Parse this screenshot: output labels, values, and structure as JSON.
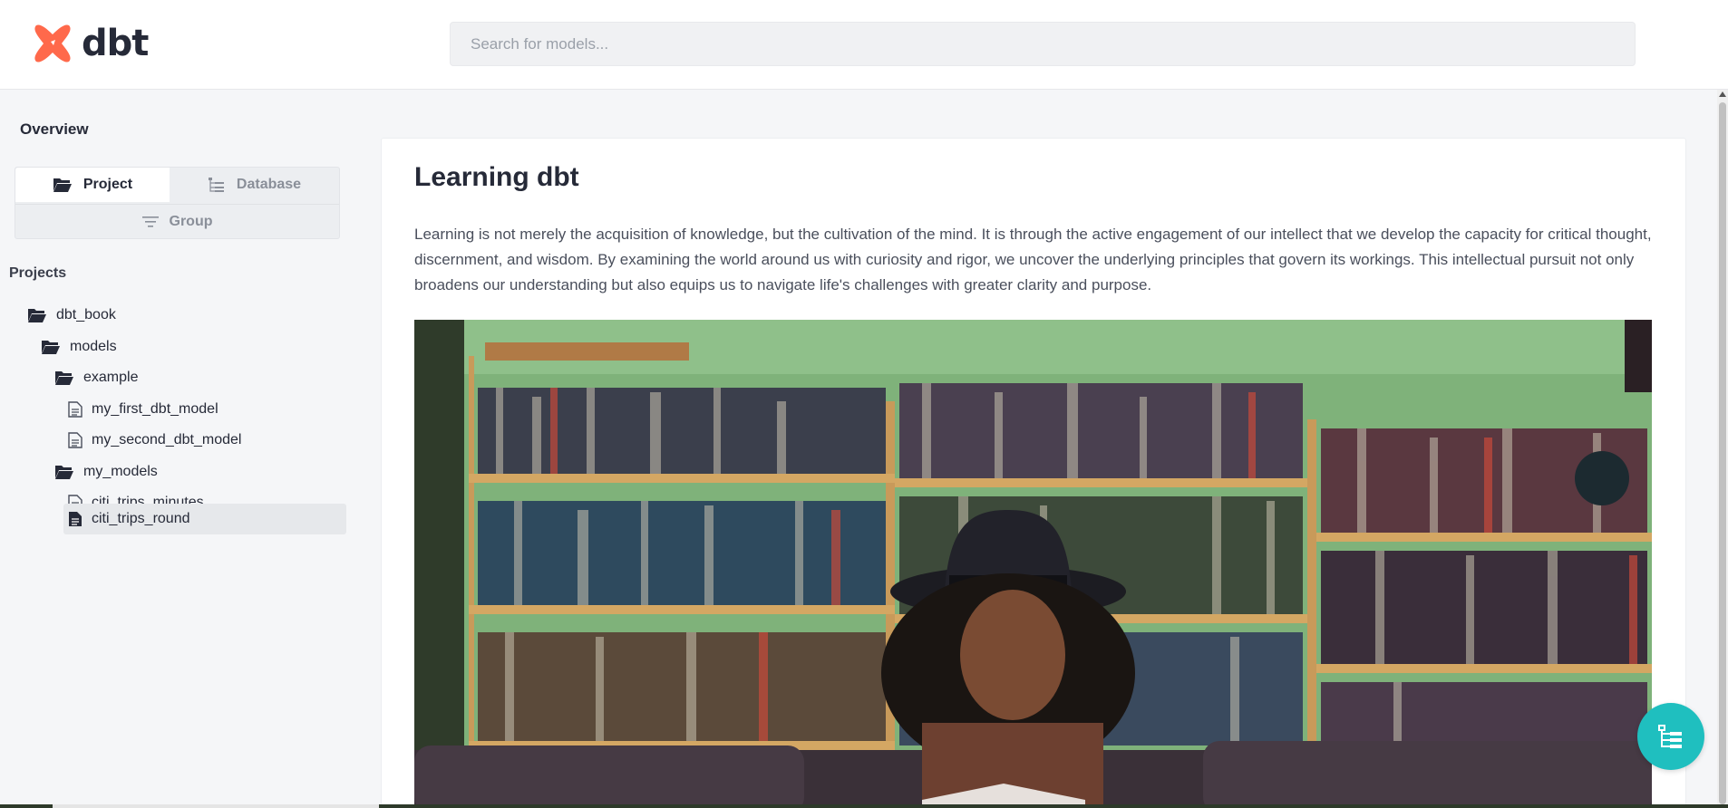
{
  "header": {
    "logo_text": "dbt",
    "search_placeholder": "Search for models..."
  },
  "sidebar": {
    "overview_label": "Overview",
    "tabs": {
      "project": "Project",
      "database": "Database",
      "group": "Group"
    },
    "projects_label": "Projects",
    "tree": [
      {
        "label": "dbt_book",
        "type": "folder",
        "level": 0
      },
      {
        "label": "models",
        "type": "folder",
        "level": 1
      },
      {
        "label": "example",
        "type": "folder",
        "level": 2
      },
      {
        "label": "my_first_dbt_model",
        "type": "file",
        "level": 3
      },
      {
        "label": "my_second_dbt_model",
        "type": "file",
        "level": 3
      },
      {
        "label": "my_models",
        "type": "folder",
        "level": 2
      },
      {
        "label": "citi_trips_minutes",
        "type": "file",
        "level": 3
      },
      {
        "label": "citi_trips_round",
        "type": "file",
        "level": 3,
        "selected": true
      }
    ]
  },
  "main": {
    "title": "Learning dbt",
    "body": "Learning is not merely the acquisition of knowledge, but the cultivation of the mind. It is through the active engagement of our intellect that we develop the capacity for critical thought, discernment, and wisdom. By examining the world around us with curiosity and rigor, we uncover the underlying principles that govern its workings. This intellectual pursuit not only broadens our understanding but also equips us to navigate life's challenges with greater clarity and purpose.",
    "image_description_icon": "photo-woman-reading-bookshelf"
  },
  "colors": {
    "brand_orange": "#ff694b",
    "accent_teal": "#1fbfbf",
    "text_dark": "#262a38"
  }
}
